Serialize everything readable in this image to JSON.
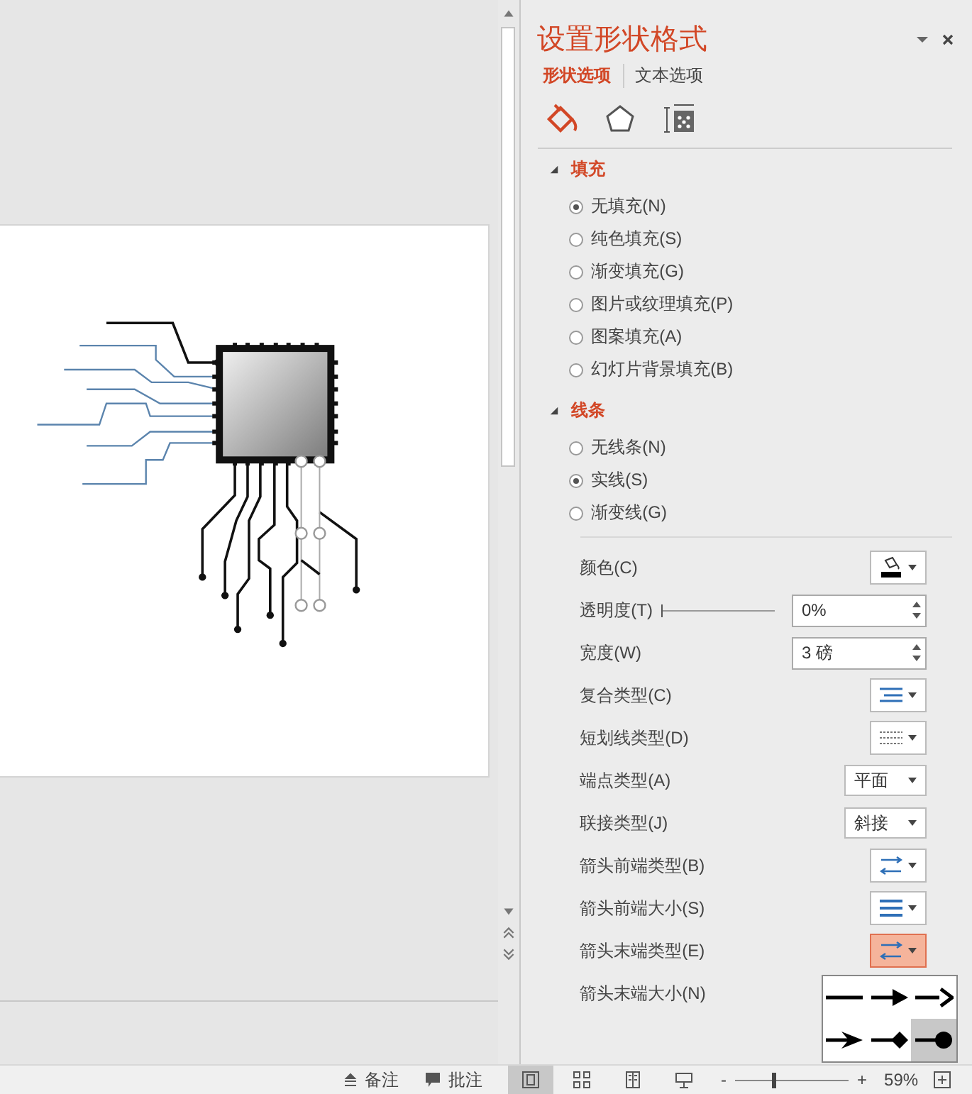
{
  "pane": {
    "title": "设置形状格式",
    "tabs": [
      {
        "label": "形状选项",
        "selected": true
      },
      {
        "label": "文本选项",
        "selected": false
      }
    ],
    "icon_tabs": [
      {
        "kind": "fill",
        "selected": true
      },
      {
        "kind": "effects",
        "selected": false
      },
      {
        "kind": "size",
        "selected": false
      }
    ],
    "sections": [
      {
        "title": "填充",
        "expanded": true,
        "options": [
          {
            "label": "无填充(N)",
            "selected": true
          },
          {
            "label": "纯色填充(S)",
            "selected": false
          },
          {
            "label": "渐变填充(G)",
            "selected": false
          },
          {
            "label": "图片或纹理填充(P)",
            "selected": false
          },
          {
            "label": "图案填充(A)",
            "selected": false
          },
          {
            "label": "幻灯片背景填充(B)",
            "selected": false
          }
        ]
      },
      {
        "title": "线条",
        "expanded": true,
        "options": [
          {
            "label": "无线条(N)",
            "selected": false
          },
          {
            "label": "实线(S)",
            "selected": true
          },
          {
            "label": "渐变线(G)",
            "selected": false
          }
        ]
      }
    ],
    "line_settings": [
      {
        "kind": "color",
        "label": "颜色(C)"
      },
      {
        "kind": "slider_spin",
        "label": "透明度(T)",
        "level": 0,
        "value": "0%"
      },
      {
        "kind": "spin",
        "label": "宽度(W)",
        "value": "3 磅"
      },
      {
        "kind": "compound",
        "label": "复合类型(C)",
        "active": false
      },
      {
        "kind": "dash",
        "label": "短划线类型(D)",
        "active": false
      },
      {
        "kind": "dropdown",
        "label": "端点类型(A)",
        "value": "平面"
      },
      {
        "kind": "dropdown",
        "label": "联接类型(J)",
        "value": "斜接"
      },
      {
        "kind": "arrow_type",
        "label": "箭头前端类型(B)",
        "active": false
      },
      {
        "kind": "arrow_size",
        "label": "箭头前端大小(S)",
        "active": false
      },
      {
        "kind": "arrow_type",
        "label": "箭头末端类型(E)",
        "active": true
      },
      {
        "kind": "label",
        "label": "箭头末端大小(N)"
      }
    ],
    "arrow_styles": [
      {
        "kind": "line",
        "selected": false
      },
      {
        "kind": "triangle",
        "selected": false
      },
      {
        "kind": "open",
        "selected": false
      },
      {
        "kind": "stealth",
        "selected": false
      },
      {
        "kind": "diamond",
        "selected": false
      },
      {
        "kind": "oval",
        "selected": true
      }
    ]
  },
  "status_bar": {
    "notes": "备注",
    "comments": "批注",
    "views": [
      {
        "kind": "normal",
        "selected": true
      },
      {
        "kind": "sorter",
        "selected": false
      },
      {
        "kind": "reading",
        "selected": false
      },
      {
        "kind": "slideshow",
        "selected": false
      }
    ],
    "zoom_minus": "-",
    "zoom_plus": "+",
    "zoom_slider": {
      "level": 0.33
    },
    "zoom": "59%"
  }
}
